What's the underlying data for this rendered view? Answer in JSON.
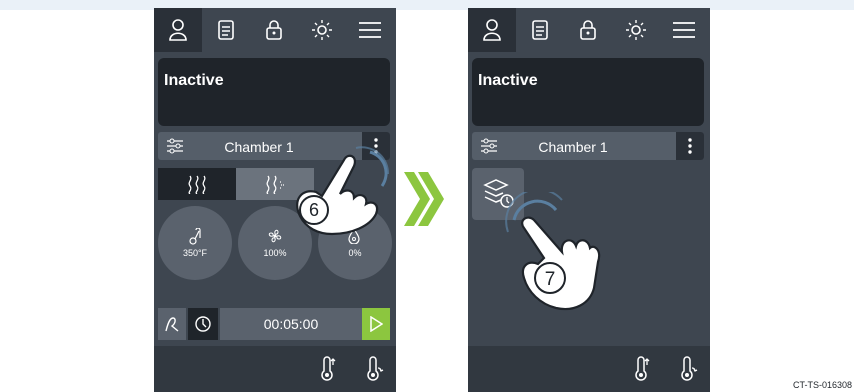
{
  "panels": [
    {
      "status": "Inactive",
      "chamber_label": "Chamber 1",
      "dials": [
        {
          "icon": "thermometer-icon",
          "value": "350°F"
        },
        {
          "icon": "fan-icon",
          "value": "100%"
        },
        {
          "icon": "humidity-drop-icon",
          "value": "0%"
        }
      ],
      "timer": "00:05:00",
      "step_label": "6"
    },
    {
      "status": "Inactive",
      "chamber_label": "Chamber 1",
      "step_label": "7"
    }
  ],
  "figure_code": "CT-TS-016308",
  "colors": {
    "screen": "#3e4650",
    "accent": "#8cc63f",
    "dark": "#1f242a"
  }
}
